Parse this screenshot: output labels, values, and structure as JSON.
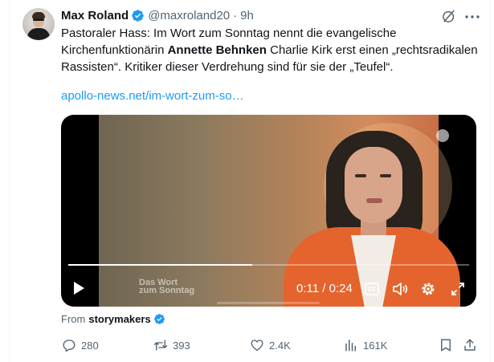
{
  "tweet": {
    "author_name": "Max Roland",
    "handle": "@maxroland20",
    "separator": "·",
    "time": "9h",
    "text_part1": "Pastoraler Hass: Im Wort zum Sonntag nennt die evangelische Kirchenfunktionärin ",
    "text_bold": "Annette Behnken",
    "text_part2": " Charlie Kirk erst einen „rechtsradikalen Rassisten“. Kritiker dieser Verdrehung sind für sie der „Teufel“.",
    "link_text": "apollo-news.net/im-wort-zum-so…"
  },
  "video": {
    "watermark_line1": "Das Wort",
    "watermark_line2": "zum Sonntag",
    "current_time": "0:11",
    "time_separator": " / ",
    "duration": "0:24",
    "progress_fraction": 0.458
  },
  "source": {
    "from_label": "From",
    "name": "storymakers"
  },
  "actions": {
    "replies": "280",
    "reposts": "393",
    "likes": "2.4K",
    "views": "161K"
  },
  "colors": {
    "accent": "#1d9bf0",
    "secondary_text": "#536471",
    "primary_text": "#0f1419"
  },
  "icons": [
    "verified-badge-icon",
    "grok-icon",
    "more-icon",
    "play-icon",
    "captions-icon",
    "volume-icon",
    "settings-icon",
    "fullscreen-icon",
    "reply-icon",
    "repost-icon",
    "like-icon",
    "views-icon",
    "bookmark-icon",
    "share-icon"
  ]
}
